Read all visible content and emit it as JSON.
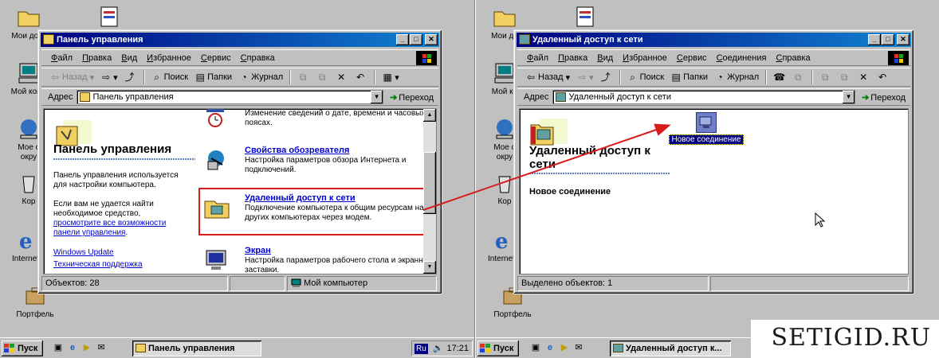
{
  "colors": {
    "titlebar": "#000080",
    "desktop": "#c0c0c0",
    "link": "#0000cc",
    "highlight": "#d81c1c",
    "selection": "#000080"
  },
  "desktop_left": {
    "icons": [
      "Мои доку",
      "Мой комп",
      "Мое с\nокру",
      "Кор",
      "Internet",
      "Портфель"
    ]
  },
  "desktop_right": {
    "icons": [
      "Мои до",
      "Мой ко",
      "Мое с\nокру",
      "Кор",
      "Internet",
      "Портфель"
    ]
  },
  "left_window": {
    "title": "Панель управления",
    "menu": [
      "Файл",
      "Правка",
      "Вид",
      "Избранное",
      "Сервис",
      "Справка"
    ],
    "toolbar": {
      "back": "Назад",
      "search": "Поиск",
      "folders": "Папки",
      "journal": "Журнал"
    },
    "address_label": "Адрес",
    "address_value": "Панель управления",
    "go_label": "Переход",
    "webview": {
      "title": "Панель управления",
      "desc1": "Панель управления используется для настройки компьютера.",
      "desc2": "Если вам не удается найти необходимое средство,",
      "link_more": "просмотрите все возможности панели управления",
      "period": ".",
      "link_update": "Windows Update",
      "link_support": "Техническая поддержка"
    },
    "items": [
      {
        "name": "",
        "desc": "Изменение сведений о дате, времени и часовых поясах."
      },
      {
        "name": "Свойства обозревателя",
        "desc": "Настройка параметров обзора Интернета и подключений."
      },
      {
        "name": "Удаленный доступ к сети",
        "desc": "Подключение компьютера к общим ресурсам на других компьютерах через модем."
      },
      {
        "name": "Экран",
        "desc": "Настройка параметров рабочего стола и экранной заставки."
      }
    ],
    "status": {
      "objects": "Объектов: 28",
      "computer": "Мой компьютер"
    }
  },
  "right_window": {
    "title": "Удаленный доступ к сети",
    "menu": [
      "Файл",
      "Правка",
      "Вид",
      "Избранное",
      "Сервис",
      "Соединения",
      "Справка"
    ],
    "toolbar": {
      "back": "Назад",
      "search": "Поиск",
      "folders": "Папки",
      "journal": "Журнал"
    },
    "address_label": "Адрес",
    "address_value": "Удаленный доступ к сети",
    "go_label": "Переход",
    "webview": {
      "title": "Удаленный доступ к сети",
      "subtitle": "Новое соединение"
    },
    "new_connection": "Новое соединение",
    "status": {
      "selected": "Выделено объектов: 1"
    }
  },
  "taskbar_left": {
    "start": "Пуск",
    "task": "Панель управления",
    "lang": "Ru",
    "time": "17:21"
  },
  "taskbar_right": {
    "start": "Пуск",
    "task": "Удаленный доступ к..."
  },
  "watermark": "SETIGID.RU"
}
